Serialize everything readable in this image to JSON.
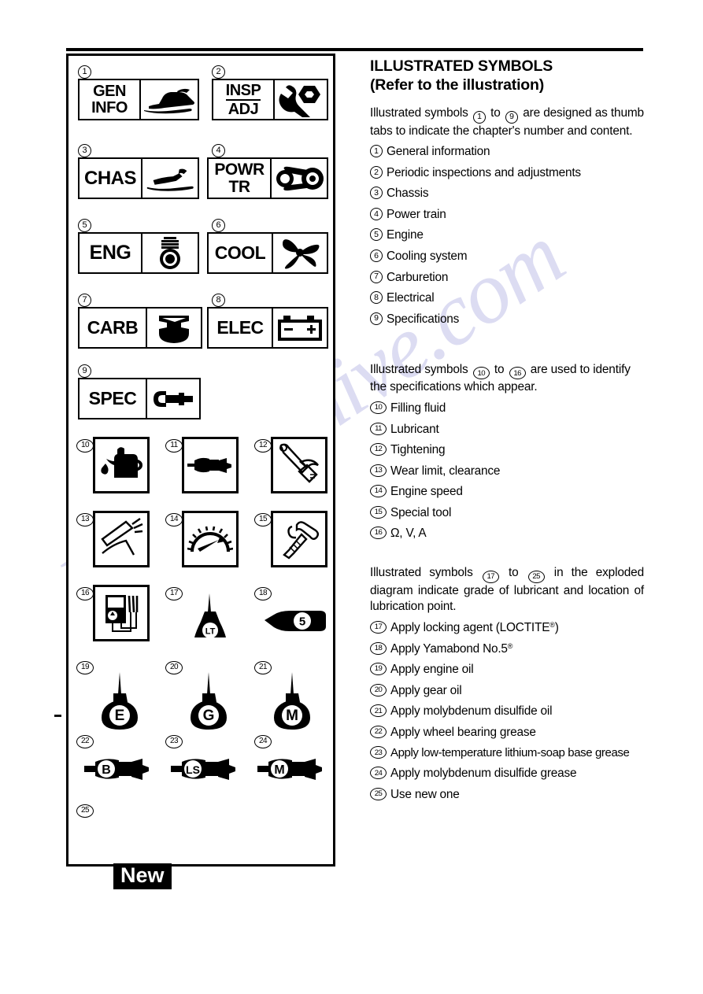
{
  "page": {
    "watermark": "manualshive.com"
  },
  "left_panel": {
    "chapter_tabs": [
      {
        "num": "1",
        "label_line1": "GEN",
        "label_line2": "INFO",
        "pictogram": "snowmobile-icon",
        "ruled": false
      },
      {
        "num": "2",
        "label_line1": "INSP",
        "label_line2": "ADJ",
        "pictogram": "wrench-bolt-icon",
        "ruled": true
      },
      {
        "num": "3",
        "label_line1": "CHAS",
        "label_line2": "",
        "pictogram": "chassis-ski-icon",
        "ruled": false
      },
      {
        "num": "4",
        "label_line1": "POWR",
        "label_line2": "TR",
        "pictogram": "drive-belt-pulley-icon",
        "ruled": false
      },
      {
        "num": "5",
        "label_line1": "ENG",
        "label_line2": "",
        "pictogram": "piston-icon",
        "ruled": false
      },
      {
        "num": "6",
        "label_line1": "COOL",
        "label_line2": "",
        "pictogram": "fan-icon",
        "ruled": false
      },
      {
        "num": "7",
        "label_line1": "CARB",
        "label_line2": "",
        "pictogram": "carburetor-icon",
        "ruled": false
      },
      {
        "num": "8",
        "label_line1": "ELEC",
        "label_line2": "",
        "pictogram": "battery-icon",
        "ruled": false
      },
      {
        "num": "9",
        "label_line1": "SPEC",
        "label_line2": "",
        "pictogram": "micrometer-icon",
        "ruled": false
      }
    ],
    "spec_icons": [
      {
        "num": "10",
        "icon": "oil-can-pour-icon",
        "boxed": true
      },
      {
        "num": "11",
        "icon": "grease-gun-icon",
        "boxed": true
      },
      {
        "num": "12",
        "icon": "torque-wrench-icon",
        "boxed": true
      },
      {
        "num": "13",
        "icon": "caliper-wear-icon",
        "boxed": true
      },
      {
        "num": "14",
        "icon": "tachometer-icon",
        "boxed": true
      },
      {
        "num": "15",
        "icon": "special-tool-icon",
        "boxed": true
      },
      {
        "num": "16",
        "icon": "multimeter-icon",
        "boxed": true
      },
      {
        "num": "17",
        "icon": "loctite-bottle-lt-icon",
        "boxed": false,
        "mark": "LT"
      },
      {
        "num": "18",
        "icon": "yamabond-tube-5-icon",
        "boxed": false,
        "mark": "5"
      }
    ],
    "lubricant_icons": [
      {
        "num": "19",
        "icon": "oil-can-icon",
        "mark": "E"
      },
      {
        "num": "20",
        "icon": "oil-can-icon",
        "mark": "G"
      },
      {
        "num": "21",
        "icon": "oil-can-icon",
        "mark": "M"
      },
      {
        "num": "22",
        "icon": "grease-gun-icon",
        "mark": "B"
      },
      {
        "num": "23",
        "icon": "grease-gun-icon",
        "mark": "LS"
      },
      {
        "num": "24",
        "icon": "grease-gun-icon",
        "mark": "M"
      }
    ],
    "new_symbol": {
      "num": "25",
      "label": "New"
    }
  },
  "right_column": {
    "heading_line1": "ILLUSTRATED SYMBOLS",
    "heading_line2": "(Refer to the illustration)",
    "intro1": {
      "pre": "Illustrated symbols",
      "from": "1",
      "mid": "to",
      "to": "9",
      "post": "are designed as thumb tabs to indicate the chapter's number and content."
    },
    "list1": [
      {
        "num": "1",
        "text": "General information"
      },
      {
        "num": "2",
        "text": "Periodic inspections and adjustments"
      },
      {
        "num": "3",
        "text": "Chassis"
      },
      {
        "num": "4",
        "text": "Power train"
      },
      {
        "num": "5",
        "text": "Engine"
      },
      {
        "num": "6",
        "text": "Cooling system"
      },
      {
        "num": "7",
        "text": "Carburetion"
      },
      {
        "num": "8",
        "text": "Electrical"
      },
      {
        "num": "9",
        "text": "Specifications"
      }
    ],
    "intro2": {
      "pre": "Illustrated symbols",
      "from": "10",
      "mid": "to",
      "to": "16",
      "post": "are used to identify the specifications which appear."
    },
    "list2": [
      {
        "num": "10",
        "text": "Filling fluid"
      },
      {
        "num": "11",
        "text": "Lubricant"
      },
      {
        "num": "12",
        "text": "Tightening"
      },
      {
        "num": "13",
        "text": "Wear limit, clearance"
      },
      {
        "num": "14",
        "text": "Engine speed"
      },
      {
        "num": "15",
        "text": "Special tool"
      },
      {
        "num": "16",
        "text": "Ω, V, A"
      }
    ],
    "intro3": {
      "pre": "Illustrated symbols",
      "from": "17",
      "mid": "to",
      "to": "25",
      "post": "in the exploded diagram indicate grade of lubricant and location of lubrication point."
    },
    "list3": [
      {
        "num": "17",
        "text": "Apply locking agent (LOCTITE",
        "suffix": ")"
      },
      {
        "num": "18",
        "text": "Apply Yamabond No.5",
        "suffix": ""
      },
      {
        "num": "19",
        "text": "Apply engine oil"
      },
      {
        "num": "20",
        "text": "Apply gear oil"
      },
      {
        "num": "21",
        "text": "Apply molybdenum disulfide oil"
      },
      {
        "num": "22",
        "text": "Apply wheel bearing grease"
      },
      {
        "num": "23",
        "text": "Apply low-temperature lithium-soap base grease"
      },
      {
        "num": "24",
        "text": "Apply molybdenum disulfide grease"
      },
      {
        "num": "25",
        "text": "Use new one"
      }
    ]
  }
}
